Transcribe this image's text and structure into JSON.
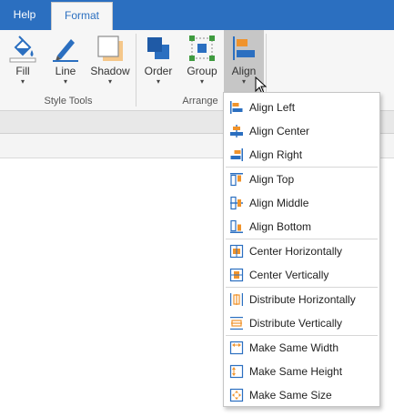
{
  "tabs": [
    {
      "label": "Help"
    },
    {
      "label": "Format"
    }
  ],
  "ribbon": {
    "buttons": [
      {
        "label": "Fill",
        "icon": "paint-bucket-icon"
      },
      {
        "label": "Line",
        "icon": "pen-icon"
      },
      {
        "label": "Shadow",
        "icon": "shadow-icon"
      },
      {
        "label": "Order",
        "icon": "order-icon"
      },
      {
        "label": "Group",
        "icon": "group-icon"
      },
      {
        "label": "Align",
        "icon": "align-icon"
      }
    ],
    "groups": [
      {
        "label": "Style Tools"
      },
      {
        "label": "Arrange"
      }
    ],
    "dropdown_glyph": "▾"
  },
  "align_menu": {
    "items": [
      {
        "label": "Align Left",
        "icon": "align-left-icon"
      },
      {
        "label": "Align Center",
        "icon": "align-center-icon"
      },
      {
        "label": "Align Right",
        "icon": "align-right-icon"
      },
      {
        "label": "Align Top",
        "icon": "align-top-icon"
      },
      {
        "label": "Align Middle",
        "icon": "align-middle-icon"
      },
      {
        "label": "Align Bottom",
        "icon": "align-bottom-icon"
      },
      {
        "label": "Center Horizontally",
        "icon": "center-horizontally-icon"
      },
      {
        "label": "Center Vertically",
        "icon": "center-vertically-icon"
      },
      {
        "label": "Distribute Horizontally",
        "icon": "distribute-horizontally-icon"
      },
      {
        "label": "Distribute Vertically",
        "icon": "distribute-vertically-icon"
      },
      {
        "label": "Make Same Width",
        "icon": "same-width-icon"
      },
      {
        "label": "Make Same Height",
        "icon": "same-height-icon"
      },
      {
        "label": "Make Same Size",
        "icon": "same-size-icon"
      }
    ]
  },
  "colors": {
    "accent": "#2b6fc0",
    "icon_orange": "#f0932b",
    "icon_blue": "#2b6fc0",
    "icon_green": "#3f9b3f"
  }
}
